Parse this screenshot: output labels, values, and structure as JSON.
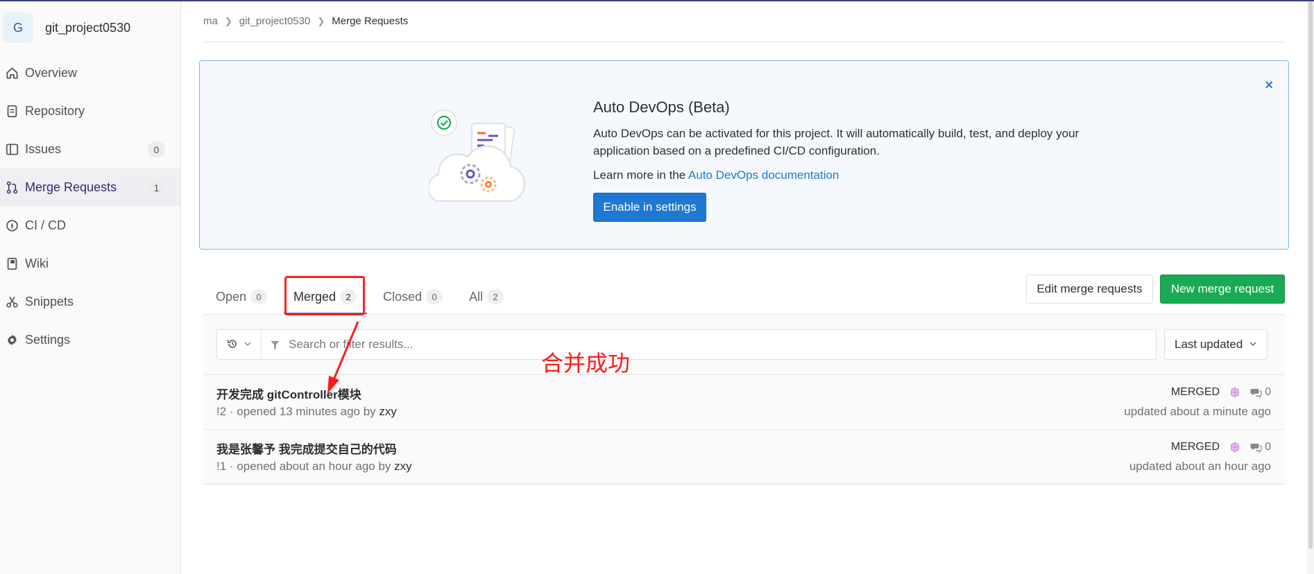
{
  "project": {
    "avatar_letter": "G",
    "name": "git_project0530"
  },
  "sidebar": {
    "items": [
      {
        "label": "Overview",
        "icon": "home-icon"
      },
      {
        "label": "Repository",
        "icon": "doc-icon"
      },
      {
        "label": "Issues",
        "icon": "issues-icon",
        "count": "0"
      },
      {
        "label": "Merge Requests",
        "icon": "merge-request-icon",
        "count": "1",
        "active": true
      },
      {
        "label": "CI / CD",
        "icon": "rocket-icon"
      },
      {
        "label": "Wiki",
        "icon": "book-icon"
      },
      {
        "label": "Snippets",
        "icon": "scissors-icon"
      },
      {
        "label": "Settings",
        "icon": "gear-icon"
      }
    ]
  },
  "breadcrumb": {
    "items": [
      "ma",
      "git_project0530",
      "Merge Requests"
    ]
  },
  "banner": {
    "title": "Auto DevOps (Beta)",
    "text": "Auto DevOps can be activated for this project. It will automatically build, test, and deploy your application based on a predefined CI/CD configuration.",
    "learn_prefix": "Learn more in the ",
    "learn_link": "Auto DevOps documentation",
    "button": "Enable in settings",
    "close": "×"
  },
  "tabs": [
    {
      "label": "Open",
      "count": "0"
    },
    {
      "label": "Merged",
      "count": "2",
      "active": true
    },
    {
      "label": "Closed",
      "count": "0"
    },
    {
      "label": "All",
      "count": "2"
    }
  ],
  "actions": {
    "edit": "Edit merge requests",
    "new": "New merge request"
  },
  "filter": {
    "placeholder": "Search or filter results...",
    "sort": "Last updated"
  },
  "annotation": {
    "text": "合并成功",
    "color": "#ff1a1a"
  },
  "merge_requests": [
    {
      "title": "开发完成 gitController模块",
      "meta_prefix": "!2 · opened 13 minutes ago by ",
      "author": "zxy",
      "status": "MERGED",
      "comments": "0",
      "updated": "updated about a minute ago"
    },
    {
      "title": "我是张馨予 我完成提交自己的代码",
      "meta_prefix": "!1 · opened about an hour ago by ",
      "author": "zxy",
      "status": "MERGED",
      "comments": "0",
      "updated": "updated about an hour ago"
    }
  ],
  "colors": {
    "accent_blue": "#1f78d1",
    "success_green": "#1aaa55",
    "active_tab_underline": "#5a5fb0"
  }
}
